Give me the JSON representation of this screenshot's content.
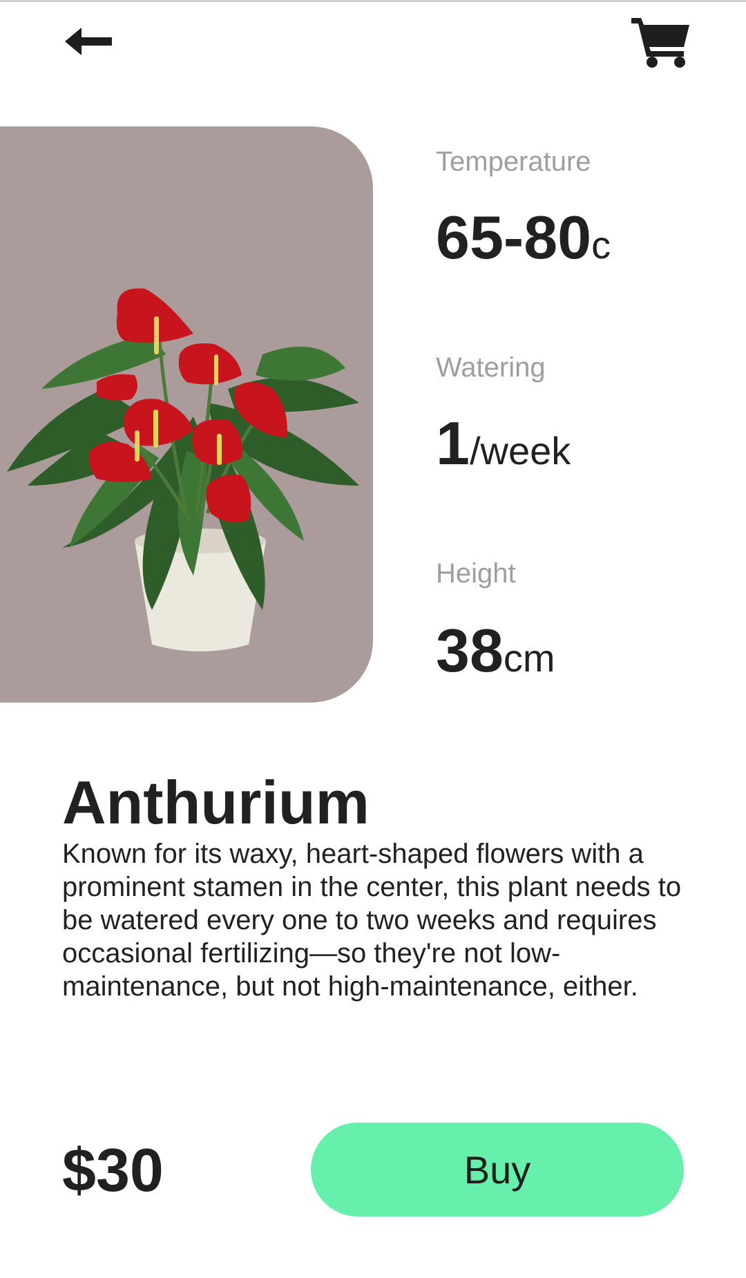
{
  "header": {
    "back_icon": "arrow-left-icon",
    "cart_icon": "shopping-cart-icon"
  },
  "plant": {
    "image_icon": "anthurium-plant-image",
    "name": "Anthurium",
    "description": "Known for its waxy, heart-shaped flowers with a prominent stamen in the center, this plant needs to be watered every one to two weeks and requires occasional fertilizing—so they're not low-maintenance, but not high-maintenance, either.",
    "price": "$30"
  },
  "stats": {
    "temperature": {
      "label": "Temperature",
      "value": "65-80",
      "unit": "c"
    },
    "watering": {
      "label": "Watering",
      "value": "1",
      "unit": "/week"
    },
    "height": {
      "label": "Height",
      "value": "38",
      "unit": "cm"
    }
  },
  "actions": {
    "buy_label": "Buy"
  },
  "colors": {
    "accent": "#67efac",
    "hero_background": "#ab9c9b",
    "label_gray": "#9e9e9e",
    "text_dark": "#212121"
  }
}
